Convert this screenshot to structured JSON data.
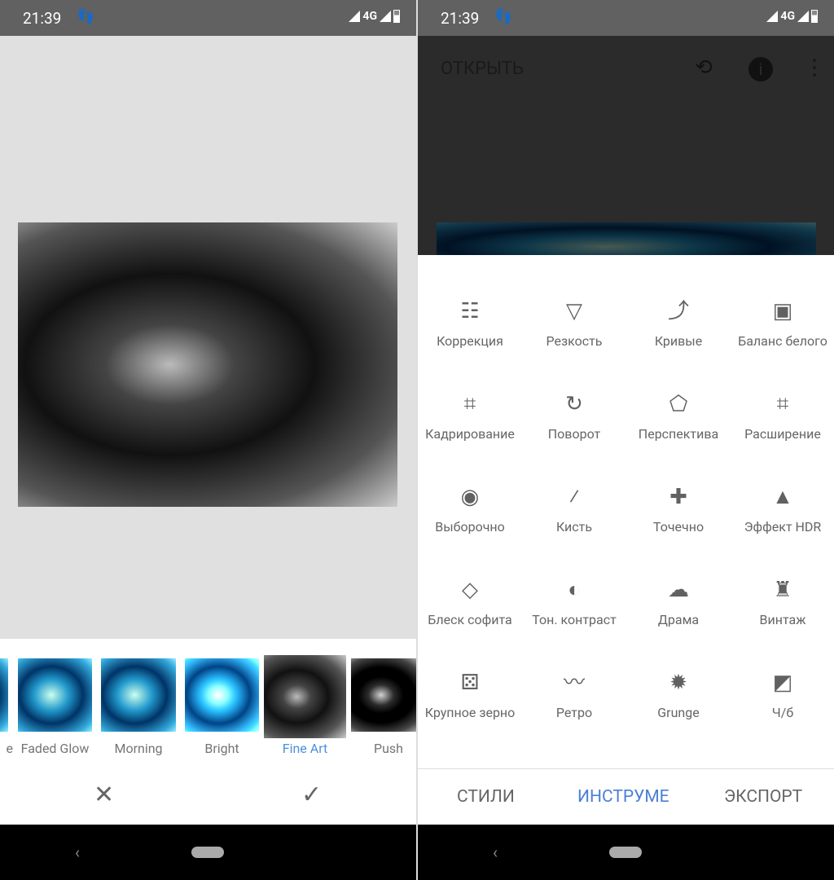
{
  "status": {
    "time": "21:39",
    "network": "4G"
  },
  "left": {
    "filters": [
      {
        "label": "e"
      },
      {
        "label": "Faded Glow"
      },
      {
        "label": "Morning"
      },
      {
        "label": "Bright"
      },
      {
        "label": "Fine Art",
        "selected": true
      },
      {
        "label": "Push"
      }
    ],
    "cancel_icon": "✕",
    "apply_icon": "✓"
  },
  "right": {
    "open_label": "ОТКРЫТЬ",
    "tools": [
      {
        "label": "Коррекция",
        "icon": "☷"
      },
      {
        "label": "Резкость",
        "icon": "▽"
      },
      {
        "label": "Кривые",
        "icon": "⤴"
      },
      {
        "label": "Баланс белого",
        "icon": "▣"
      },
      {
        "label": "Кадрирование",
        "icon": "⌗"
      },
      {
        "label": "Поворот",
        "icon": "↻"
      },
      {
        "label": "Перспектива",
        "icon": "⬠"
      },
      {
        "label": "Расширение",
        "icon": "⌗"
      },
      {
        "label": "Выборочно",
        "icon": "◉"
      },
      {
        "label": "Кисть",
        "icon": "⁄"
      },
      {
        "label": "Точечно",
        "icon": "✚"
      },
      {
        "label": "Эффект HDR",
        "icon": "▲"
      },
      {
        "label": "Блеск софита",
        "icon": "◇"
      },
      {
        "label": "Тон. контраст",
        "icon": "◐"
      },
      {
        "label": "Драма",
        "icon": "☁"
      },
      {
        "label": "Винтаж",
        "icon": "♜"
      },
      {
        "label": "Крупное зерно",
        "icon": "⚄"
      },
      {
        "label": "Ретро",
        "icon": "〰"
      },
      {
        "label": "Grunge",
        "icon": "✹"
      },
      {
        "label": "Ч/б",
        "icon": "◩"
      }
    ],
    "tabs": [
      {
        "label": "СТИЛИ"
      },
      {
        "label": "ИНСТРУМЕ",
        "active": true
      },
      {
        "label": "ЭКСПОРТ"
      }
    ]
  },
  "colors": {
    "accent": "#4a90d9",
    "status_bar": "#616161"
  }
}
